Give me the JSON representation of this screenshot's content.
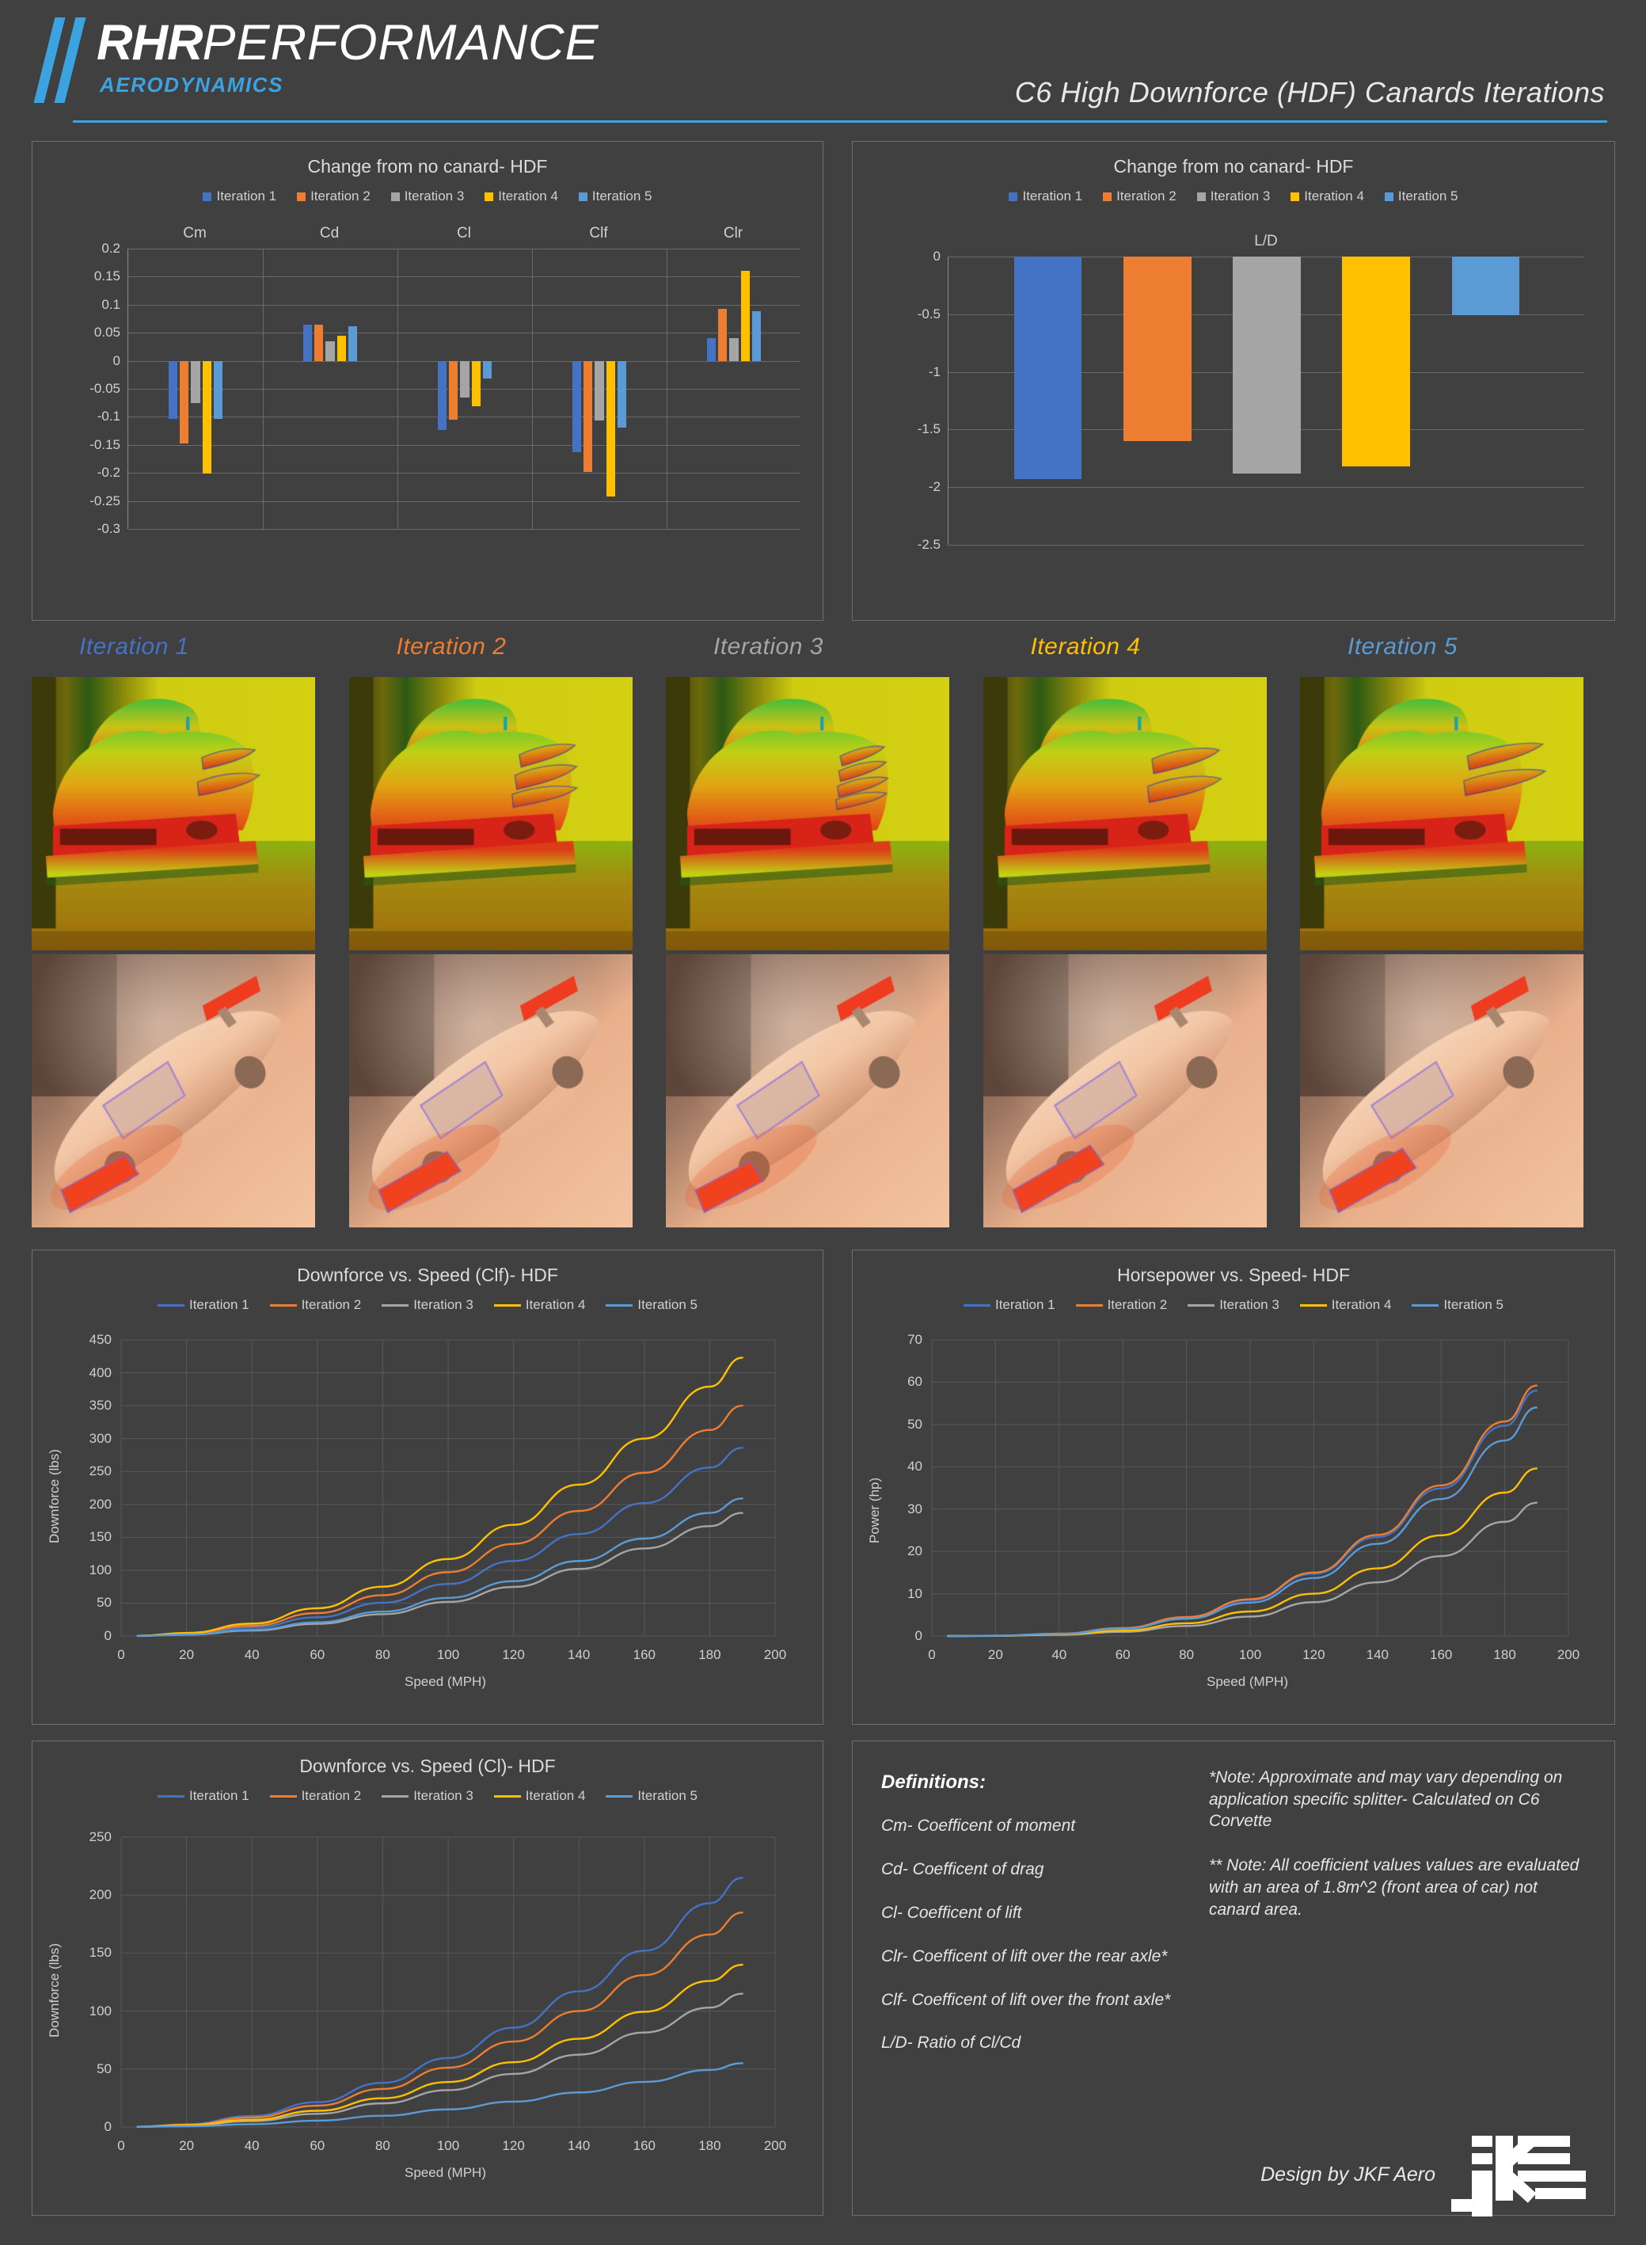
{
  "header": {
    "brand_bold": "RHR",
    "brand_light": "PERFORMANCE",
    "brand_sub": "AERODYNAMICS",
    "doc_title": "C6 High Downforce (HDF) Canards Iterations",
    "accent_color": "#3ba3e0"
  },
  "series_colors": {
    "iteration_1": "#4472C4",
    "iteration_2": "#ED7D31",
    "iteration_3": "#A5A5A5",
    "iteration_4": "#FFC000",
    "iteration_5": "#5B9BD5"
  },
  "legend_labels": [
    "Iteration 1",
    "Iteration 2",
    "Iteration 3",
    "Iteration 4",
    "Iteration 5"
  ],
  "iteration_labels": [
    {
      "label": "Iteration 1",
      "color": "#4472C4"
    },
    {
      "label": "Iteration 2",
      "color": "#ED7D31"
    },
    {
      "label": "Iteration 3",
      "color": "#A5A5A5"
    },
    {
      "label": "Iteration 4",
      "color": "#FFC000"
    },
    {
      "label": "Iteration 5",
      "color": "#5B9BD5"
    }
  ],
  "definitions": {
    "heading": "Definitions:",
    "items": [
      "Cm- Coefficent of moment",
      "Cd- Coefficent of drag",
      "Cl- Coefficent of lift",
      "Clr- Coefficent of lift over the rear axle*",
      "Clf- Coefficent of lift over the front axle*",
      "L/D- Ratio of Cl/Cd"
    ]
  },
  "notes": [
    "*Note: Approximate and may vary depending on application specific splitter- Calculated on C6 Corvette",
    "** Note: All coefficient values values are evaluated with an area of 1.8m^2 (front area of car) not canard area."
  ],
  "footer": {
    "credit": "Design by JKF Aero",
    "logo_text": "JKF"
  },
  "chart_data": [
    {
      "id": "coeff_change",
      "type": "bar",
      "title": "Change from no canard- HDF",
      "categories": [
        "Cm",
        "Cd",
        "Cl",
        "Clf",
        "Clr"
      ],
      "xlabel": "",
      "ylabel": "",
      "ylim": [
        -0.3,
        0.2
      ],
      "yticks": [
        0.2,
        0.15,
        0.1,
        0.05,
        0,
        -0.05,
        -0.1,
        -0.15,
        -0.2,
        -0.25,
        -0.3
      ],
      "ytick_labels": [
        "0.2",
        "0.15",
        "0.1",
        "0.05",
        "0",
        "-0.05",
        "-0.1",
        "-0.15",
        "-0.2",
        "-0.25",
        "-0.3"
      ],
      "grid": true,
      "legend_position": "top",
      "series": [
        {
          "name": "Iteration 1",
          "color": "#4472C4",
          "values": [
            -0.103,
            0.064,
            -0.123,
            -0.163,
            0.041
          ]
        },
        {
          "name": "Iteration 2",
          "color": "#ED7D31",
          "values": [
            -0.147,
            0.065,
            -0.105,
            -0.199,
            0.093
          ]
        },
        {
          "name": "Iteration 3",
          "color": "#A5A5A5",
          "values": [
            -0.075,
            0.035,
            -0.066,
            -0.106,
            0.041
          ]
        },
        {
          "name": "Iteration 4",
          "color": "#FFC000",
          "values": [
            -0.201,
            0.045,
            -0.081,
            -0.242,
            0.161
          ]
        },
        {
          "name": "Iteration 5",
          "color": "#5B9BD5",
          "values": [
            -0.104,
            0.061,
            -0.031,
            -0.119,
            0.088
          ]
        }
      ]
    },
    {
      "id": "ld_change",
      "type": "bar",
      "title": "Change from no canard- HDF",
      "categories": [
        "L/D"
      ],
      "category_label": "L/D",
      "xlabel": "",
      "ylabel": "",
      "ylim": [
        -2.5,
        0
      ],
      "yticks": [
        0,
        -0.5,
        -1,
        -1.5,
        -2,
        -2.5
      ],
      "ytick_labels": [
        "0",
        "-0.5",
        "-1",
        "-1.5",
        "-2",
        "-2.5"
      ],
      "grid": true,
      "legend_position": "top",
      "series": [
        {
          "name": "Iteration 1",
          "color": "#4472C4",
          "values": [
            -1.93
          ]
        },
        {
          "name": "Iteration 2",
          "color": "#ED7D31",
          "values": [
            -1.6
          ]
        },
        {
          "name": "Iteration 3",
          "color": "#A5A5A5",
          "values": [
            -1.88
          ]
        },
        {
          "name": "Iteration 4",
          "color": "#FFC000",
          "values": [
            -1.82
          ]
        },
        {
          "name": "Iteration 5",
          "color": "#5B9BD5",
          "values": [
            -0.51
          ]
        }
      ]
    },
    {
      "id": "downforce_clf",
      "type": "line",
      "title": "Downforce vs. Speed (Clf)- HDF",
      "xlabel": "Speed (MPH)",
      "ylabel": "Downforce (lbs)",
      "xlim": [
        0,
        200
      ],
      "ylim": [
        0,
        450
      ],
      "xticks": [
        0,
        20,
        40,
        60,
        80,
        100,
        120,
        140,
        160,
        180,
        200
      ],
      "yticks": [
        0,
        50,
        100,
        150,
        200,
        250,
        300,
        350,
        400,
        450
      ],
      "grid": true,
      "legend_position": "top",
      "x": [
        5,
        20,
        40,
        60,
        80,
        100,
        120,
        140,
        160,
        180,
        190
      ],
      "series": [
        {
          "name": "Iteration 1",
          "color": "#4472C4",
          "values": [
            0.2,
            3.2,
            12.7,
            28.5,
            50.6,
            79.1,
            114,
            155,
            202,
            256,
            286
          ]
        },
        {
          "name": "Iteration 2",
          "color": "#ED7D31",
          "values": [
            0.3,
            3.9,
            15.5,
            34.9,
            62,
            97,
            140,
            190,
            248,
            313,
            350
          ]
        },
        {
          "name": "Iteration 3",
          "color": "#A5A5A5",
          "values": [
            0.1,
            2.1,
            8.3,
            18.6,
            33.2,
            51.8,
            74.6,
            102,
            133,
            167,
            187
          ]
        },
        {
          "name": "Iteration 4",
          "color": "#FFC000",
          "values": [
            0.4,
            4.7,
            18.8,
            42.2,
            75,
            117,
            169,
            230,
            300,
            379,
            423
          ]
        },
        {
          "name": "Iteration 5",
          "color": "#5B9BD5",
          "values": [
            0.2,
            2.3,
            9.3,
            20.8,
            37.1,
            58,
            83.4,
            114,
            148,
            187,
            209
          ]
        }
      ]
    },
    {
      "id": "horsepower",
      "type": "line",
      "title": "Horsepower vs. Speed- HDF",
      "xlabel": "Speed (MPH)",
      "ylabel": "Power (hp)",
      "xlim": [
        0,
        200
      ],
      "ylim": [
        0,
        70
      ],
      "xticks": [
        0,
        20,
        40,
        60,
        80,
        100,
        120,
        140,
        160,
        180,
        200
      ],
      "yticks": [
        0,
        10,
        20,
        30,
        40,
        50,
        60,
        70
      ],
      "grid": true,
      "legend_position": "top",
      "x": [
        5,
        20,
        40,
        60,
        80,
        100,
        120,
        140,
        160,
        180,
        190
      ],
      "series": [
        {
          "name": "Iteration 1",
          "color": "#4472C4",
          "values": [
            0.0,
            0.07,
            0.55,
            1.85,
            4.4,
            8.5,
            14.7,
            23.4,
            34.9,
            49.7,
            58.0
          ]
        },
        {
          "name": "Iteration 2",
          "color": "#ED7D31",
          "values": [
            0.0,
            0.07,
            0.56,
            1.89,
            4.48,
            8.7,
            15.0,
            23.9,
            35.6,
            50.7,
            59.2
          ]
        },
        {
          "name": "Iteration 3",
          "color": "#A5A5A5",
          "values": [
            0.0,
            0.04,
            0.3,
            1.0,
            2.38,
            4.6,
            8.0,
            12.7,
            18.9,
            27.0,
            31.5
          ]
        },
        {
          "name": "Iteration 4",
          "color": "#FFC000",
          "values": [
            0.0,
            0.05,
            0.38,
            1.26,
            3.0,
            5.8,
            10.0,
            16.0,
            23.8,
            33.9,
            39.6
          ]
        },
        {
          "name": "Iteration 5",
          "color": "#5B9BD5",
          "values": [
            0.0,
            0.07,
            0.51,
            1.72,
            4.08,
            7.9,
            13.7,
            21.8,
            32.4,
            46.2,
            54.0
          ]
        }
      ]
    },
    {
      "id": "downforce_cl",
      "type": "line",
      "title": "Downforce vs. Speed (Cl)- HDF",
      "xlabel": "Speed (MPH)",
      "ylabel": "Downforce (lbs)",
      "xlim": [
        0,
        200
      ],
      "ylim": [
        0,
        250
      ],
      "xticks": [
        0,
        20,
        40,
        60,
        80,
        100,
        120,
        140,
        160,
        180,
        200
      ],
      "yticks": [
        0,
        50,
        100,
        150,
        200,
        250
      ],
      "grid": true,
      "legend_position": "top",
      "x": [
        5,
        20,
        40,
        60,
        80,
        100,
        120,
        140,
        160,
        180,
        190
      ],
      "series": [
        {
          "name": "Iteration 1",
          "color": "#4472C4",
          "values": [
            0.2,
            2.4,
            9.5,
            21.4,
            38.1,
            59.5,
            85.7,
            117,
            152,
            193,
            215
          ]
        },
        {
          "name": "Iteration 2",
          "color": "#ED7D31",
          "values": [
            0.2,
            2.0,
            8.2,
            18.4,
            32.8,
            51.2,
            73.7,
            100,
            131,
            166,
            185
          ]
        },
        {
          "name": "Iteration 3",
          "color": "#A5A5A5",
          "values": [
            0.1,
            1.3,
            5.1,
            11.4,
            20.4,
            31.8,
            45.8,
            62.4,
            81.5,
            103,
            115
          ]
        },
        {
          "name": "Iteration 4",
          "color": "#FFC000",
          "values": [
            0.2,
            1.6,
            6.2,
            14.0,
            24.8,
            38.8,
            55.9,
            76.1,
            99.4,
            126,
            140
          ]
        },
        {
          "name": "Iteration 5",
          "color": "#5B9BD5",
          "values": [
            0.1,
            0.6,
            2.4,
            5.5,
            9.7,
            15.2,
            21.9,
            29.8,
            38.9,
            49.2,
            55
          ]
        }
      ]
    }
  ]
}
